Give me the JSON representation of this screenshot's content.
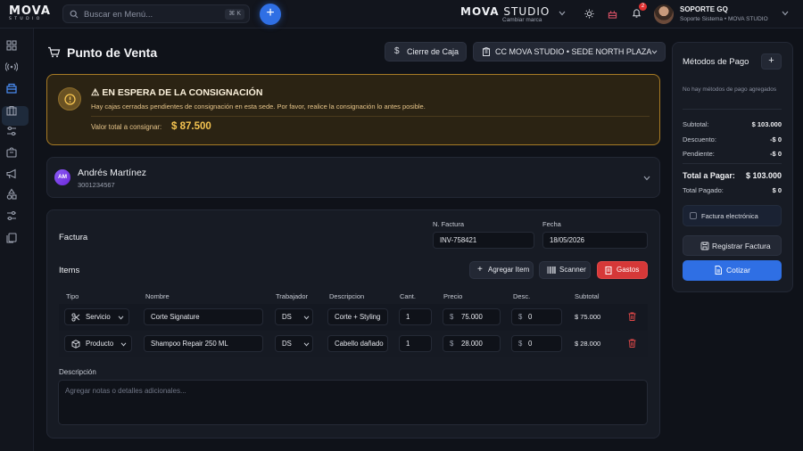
{
  "topbar": {
    "logo_main": "MOVA",
    "logo_sub": "STUDIO",
    "search_placeholder": "Buscar en Menú...",
    "search_shortcut": "⌘ K",
    "add_label": "+",
    "brand_name_bold": "MOVA",
    "brand_name_light": " STUDIO",
    "brand_switch": "Cambiar marca",
    "notifications_count": "2",
    "user_name": "SOPORTE GQ",
    "user_role": "Soporte Sistema",
    "user_org": "• MOVA STUDIO"
  },
  "page": {
    "title": "Punto de Venta",
    "cash_close_label": "Cierre de Caja",
    "branch_label": "CC MOVA STUDIO • SEDE NORTH PLAZA"
  },
  "alert": {
    "title": "⚠ EN ESPERA DE LA CONSIGNACIÓN",
    "body": "Hay cajas cerradas pendientes de consignación en esta sede. Por favor, realice la consignación lo antes posible.",
    "total_label": "Valor total a consignar:",
    "total_value": "$ 87.500",
    "accent": "#f5c451"
  },
  "client": {
    "initials": "AM",
    "name": "Andrés Martínez",
    "phone": "3001234567"
  },
  "invoice": {
    "section_label": "Factura",
    "number_label": "N. Factura",
    "number_value": "INV-758421",
    "date_label": "Fecha",
    "date_value": "18/05/2026"
  },
  "items": {
    "section_label": "Items",
    "add_item_label": "Agregar Item",
    "scanner_label": "Scanner",
    "expenses_label": "Gastos",
    "columns": [
      "Tipo",
      "Nombre",
      "Trabajador",
      "Descripcion",
      "Cant.",
      "Precio",
      "Desc.",
      "Subtotal"
    ],
    "rows": [
      {
        "type": "Servicio",
        "name": "Corte Signature",
        "worker": "DS",
        "description": "Corte + Styling",
        "qty": "1",
        "price": "75.000",
        "discount": "0",
        "subtotal": "$ 75.000"
      },
      {
        "type": "Producto",
        "name": "Shampoo Repair 250 ML",
        "worker": "DS",
        "description": "Cabello dañado",
        "qty": "1",
        "price": "28.000",
        "discount": "0",
        "subtotal": "$ 28.000"
      }
    ],
    "currency_symbol": "$"
  },
  "description": {
    "label": "Descripción",
    "placeholder": "Agregar notas o detalles adicionales..."
  },
  "payment": {
    "title": "Métodos de Pago",
    "empty": "No hay métodos de pago agregados",
    "subtotal_label": "Subtotal:",
    "subtotal_value": "$ 103.000",
    "discount_label": "Descuento:",
    "discount_value": "-$ 0",
    "pending_label": "Pendiente:",
    "pending_value": "-$ 0",
    "total_label": "Total a Pagar:",
    "total_value": "$ 103.000",
    "paid_label": "Total Pagado:",
    "paid_value": "$ 0",
    "einvoice_label": "Factura electrónica",
    "register_label": "Registrar Factura",
    "quote_label": "Cotizar"
  }
}
